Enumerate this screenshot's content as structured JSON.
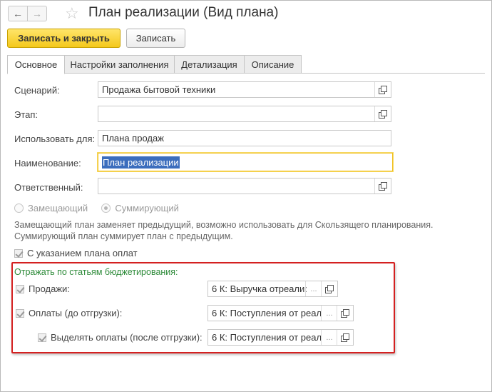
{
  "window": {
    "title": "План реализации (Вид плана)",
    "back_glyph": "←",
    "forward_glyph": "→",
    "favorite_glyph": "☆"
  },
  "toolbar": {
    "save_close_label": "Записать и закрыть",
    "save_label": "Записать"
  },
  "tabs": [
    {
      "label": "Основное",
      "active": true
    },
    {
      "label": "Настройки заполнения",
      "active": false
    },
    {
      "label": "Детализация",
      "active": false
    },
    {
      "label": "Описание",
      "active": false
    }
  ],
  "form": {
    "scenario": {
      "label": "Сценарий:",
      "value": "Продажа бытовой техники"
    },
    "stage": {
      "label": "Этап:",
      "value": ""
    },
    "use_for": {
      "label": "Использовать для:",
      "value": "Плана продаж"
    },
    "name": {
      "label": "Наименование:",
      "value": "План реализации"
    },
    "responsible": {
      "label": "Ответственный:",
      "value": ""
    },
    "radio": {
      "option1": "Замещающий",
      "option2": "Суммирующий"
    },
    "note_line1": "Замещающий план заменяет предыдущий, возможно использовать для Скользящего планирования.",
    "note_line2": "Суммирующий план суммирует план с предыдущим.",
    "payment_schedule": {
      "label": "С указанием плана оплат",
      "checked": true
    }
  },
  "budget": {
    "section_label": "Отражать по статьям бюджетирования:",
    "sales": {
      "label": "Продажи:",
      "value": "6 К: Выручка отреали:",
      "checked": true
    },
    "payments": {
      "label": "Оплаты (до отгрузки):",
      "value": "6 К: Поступления от реал",
      "checked": true
    },
    "post_payments": {
      "label": "Выделять оплаты (после отгрузки):",
      "value": "6 К: Поступления от реал",
      "checked": true
    },
    "dots_label": "..."
  },
  "colors": {
    "accent_yellow": "#f4c81b",
    "highlight_red": "#d42020",
    "section_green": "#2e8b3a",
    "selection_blue": "#3b6dbd"
  }
}
